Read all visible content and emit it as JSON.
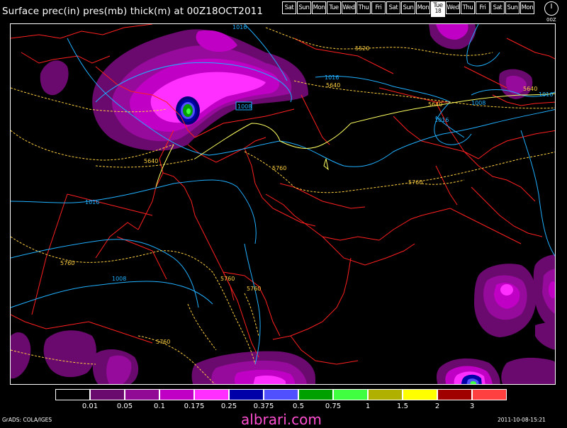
{
  "title": "Surface prec(in) pres(mb) thick(m) at 00Z18OCT2011",
  "days": [
    {
      "label": "Sat"
    },
    {
      "label": "Sun"
    },
    {
      "label": "Mon"
    },
    {
      "label": "Tue"
    },
    {
      "label": "Wed"
    },
    {
      "label": "Thu"
    },
    {
      "label": "Fri"
    },
    {
      "label": "Sat"
    },
    {
      "label": "Sun"
    },
    {
      "label": "Mon"
    },
    {
      "label": "Tue",
      "num": "18",
      "selected": true
    },
    {
      "label": "Wed"
    },
    {
      "label": "Thu"
    },
    {
      "label": "Fri"
    },
    {
      "label": "Sat"
    },
    {
      "label": "Sun"
    },
    {
      "label": "Mon"
    }
  ],
  "clock_label": "00Z",
  "legend": {
    "colors": [
      "#000000",
      "#6a0a6e",
      "#900a96",
      "#c000c4",
      "#ff30ff",
      "#0000a8",
      "#5050ff",
      "#00a000",
      "#40ff40",
      "#b0b000",
      "#ffff00",
      "#a00000",
      "#ff4040"
    ],
    "labels": [
      "0.01",
      "0.05",
      "0.1",
      "0.175",
      "0.25",
      "0.375",
      "0.5",
      "0.75",
      "1",
      "1.5",
      "2",
      "3"
    ]
  },
  "isobar_labels": [
    "1016",
    "1016",
    "1016",
    "1016",
    "1008",
    "1008",
    "1008",
    "1016"
  ],
  "thickness_labels": [
    "5520",
    "5640",
    "5640",
    "5640",
    "5640",
    "5760",
    "5760",
    "5760",
    "5760",
    "5760",
    "5760"
  ],
  "footer_left": "GrADS: COLA/IGES",
  "watermark": "albrari.com",
  "timestamp": "2011-10-08-15:21"
}
